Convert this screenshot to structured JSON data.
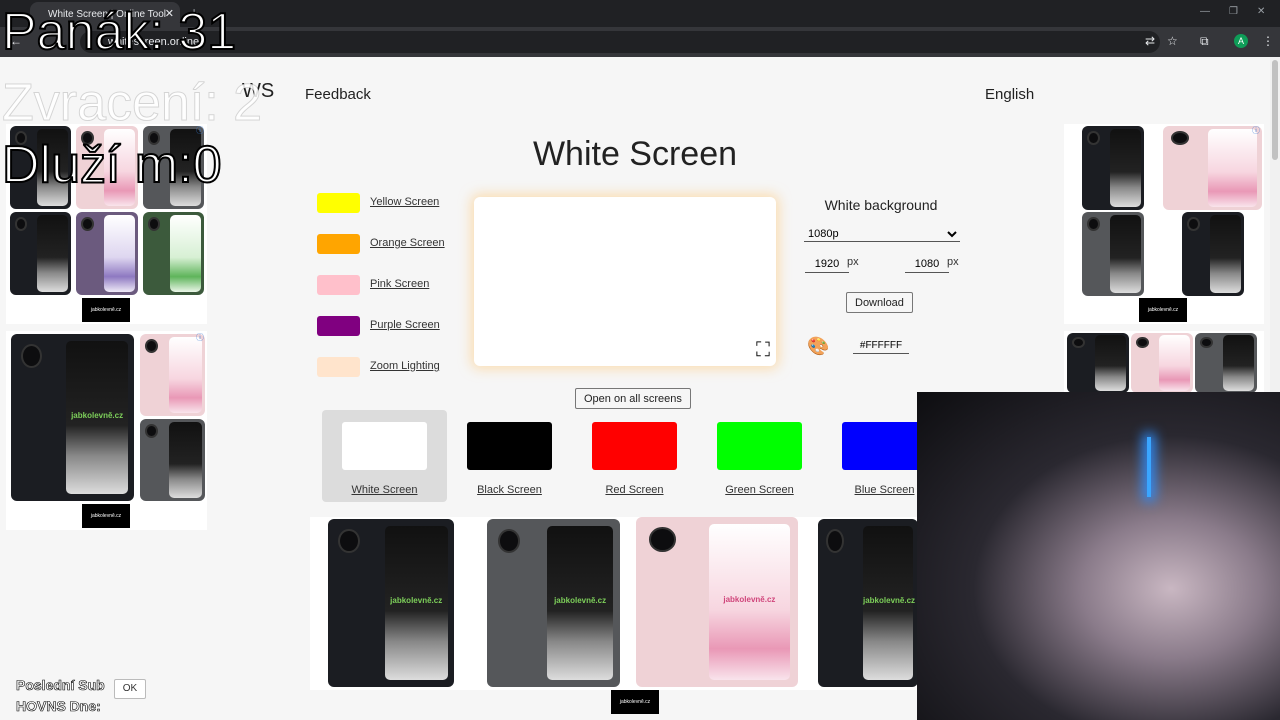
{
  "browser": {
    "tab_title": "White Screen | Online Tool",
    "url": "whitescreen.online",
    "avatar_letter": "A"
  },
  "site": {
    "logo": "WS",
    "nav_feedback": "Feedback",
    "language": "English",
    "title": "White Screen"
  },
  "swatches": [
    {
      "label": "Yellow Screen",
      "color": "#ffff00"
    },
    {
      "label": "Orange Screen",
      "color": "#ffa500"
    },
    {
      "label": "Pink Screen",
      "color": "#ffc0cb"
    },
    {
      "label": "Purple Screen",
      "color": "#800080"
    },
    {
      "label": "Zoom Lighting",
      "color": "#ffe4cc"
    }
  ],
  "settings": {
    "title": "White background",
    "resolution": "1080p",
    "width": "1920",
    "height": "1080",
    "unit": "px",
    "download": "Download",
    "hex": "#FFFFFF"
  },
  "open_all": "Open on all screens",
  "color_cards": [
    {
      "label": "White Screen",
      "color": "#ffffff"
    },
    {
      "label": "Black Screen",
      "color": "#000000"
    },
    {
      "label": "Red Screen",
      "color": "#ff0000"
    },
    {
      "label": "Green Screen",
      "color": "#00ff00"
    },
    {
      "label": "Blue Screen",
      "color": "#0000ff"
    }
  ],
  "ads": {
    "brand": "jabkolevně.cz"
  },
  "overlay": {
    "stat1": "Panák: 31",
    "stat2": "Zvracení: 2",
    "stat3": "Dluží m:0",
    "last_sub": "Poslední Sub",
    "hovns": "HOVNS Dne:",
    "ok": "OK"
  }
}
